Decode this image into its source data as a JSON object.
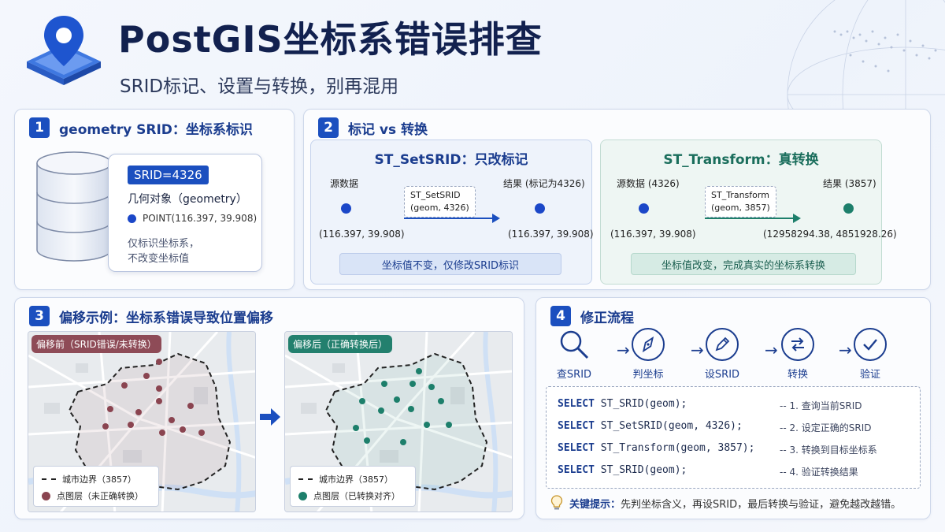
{
  "header": {
    "title": "PostGIS坐标系错误排查",
    "subtitle": "SRID标记、设置与转换，别再混用"
  },
  "panel1": {
    "num": "1",
    "title": "geometry SRID：坐标系标识",
    "srid_tag": "SRID=4326",
    "geometry_label": "几何对象（geometry）",
    "point_text": "POINT(116.397, 39.908)",
    "note_line1": "仅标识坐标系，",
    "note_line2": "不改变坐标值"
  },
  "panel2": {
    "num": "2",
    "title": "标记 vs 转换",
    "setsrid": {
      "title": "ST_SetSRID：只改标记",
      "src_label": "源数据",
      "result_label": "结果 (标记为4326)",
      "fn_line1": "ST_SetSRID",
      "fn_line2": "(geom, 4326)",
      "src_coord": "(116.397, 39.908)",
      "result_coord": "(116.397, 39.908)",
      "note": "坐标值不变，仅修改SRID标识"
    },
    "transform": {
      "title": "ST_Transform：真转换",
      "src_label": "源数据 (4326)",
      "result_label": "结果 (3857)",
      "fn_line1": "ST_Transform",
      "fn_line2": "(geom, 3857)",
      "src_coord": "(116.397, 39.908)",
      "result_coord": "(12958294.38, 4851928.26)",
      "note": "坐标值改变，完成真实的坐标系转换"
    }
  },
  "panel3": {
    "num": "3",
    "title": "偏移示例：坐标系错误导致位置偏移",
    "before_tag": "偏移前（SRID错误/未转换）",
    "after_tag": "偏移后（正确转换后）",
    "legend_boundary": "城市边界（3857）",
    "legend_before_points": "点图层（未正确转换）",
    "legend_after_points": "点图层（已转换对齐）"
  },
  "panel4": {
    "num": "4",
    "title": "修正流程",
    "steps": [
      {
        "label": "查SRID",
        "icon": "search-icon"
      },
      {
        "label": "判坐标",
        "icon": "compass-icon"
      },
      {
        "label": "设SRID",
        "icon": "pencil-icon"
      },
      {
        "label": "转换",
        "icon": "swap-icon"
      },
      {
        "label": "验证",
        "icon": "check-icon"
      }
    ],
    "code": [
      {
        "kw": "SELECT",
        "expr_a": " ST_SRID(geom);",
        "comment": "-- 1. 查询当前SRID"
      },
      {
        "kw": "SELECT",
        "expr_a": " ST_SetSRID(geom, 4326);",
        "comment": "-- 2. 设定正确的SRID"
      },
      {
        "kw": "SELECT",
        "expr_a": " ST_Transform(geom, 3857);",
        "comment": "-- 3. 转换到目标坐标系"
      },
      {
        "kw": "SELECT",
        "expr_a": " ST_SRID(geom);",
        "comment": "-- 4. 验证转换结果"
      }
    ],
    "tip_key": "关键提示：",
    "tip_text": "先判坐标含义，再设SRID，最后转换与验证，避免越改越错。"
  },
  "colors": {
    "primary": "#1b4fbf",
    "navy": "#12214f",
    "green": "#1d7f6b",
    "red_point": "#8a4450"
  }
}
